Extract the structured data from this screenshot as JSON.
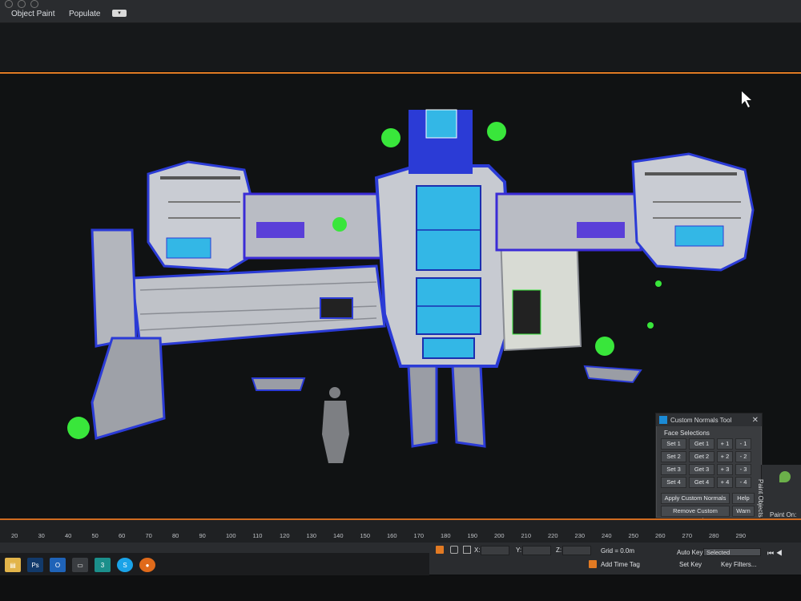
{
  "ribbon": {
    "tabs": [
      "Object Paint",
      "Populate"
    ]
  },
  "tool": {
    "title": "Custom Normals Tool",
    "section": "Face Selections",
    "rows": [
      {
        "set": "Set 1",
        "get": "Get 1",
        "plus": "+ 1",
        "minus": "- 1"
      },
      {
        "set": "Set 2",
        "get": "Get 2",
        "plus": "+ 2",
        "minus": "- 2"
      },
      {
        "set": "Set 3",
        "get": "Get 3",
        "plus": "+ 3",
        "minus": "- 3"
      },
      {
        "set": "Set 4",
        "get": "Get 4",
        "plus": "+ 4",
        "minus": "- 4"
      }
    ],
    "apply": "Apply Custom Normals",
    "help": "Help",
    "remove": "Remove Custom Normals",
    "warn": "Warn",
    "close": "✕"
  },
  "paint_panel": {
    "vertical": "Paint Objects",
    "paint_on": "Paint On:"
  },
  "timeline": {
    "ticks": [
      "20",
      "30",
      "40",
      "50",
      "60",
      "70",
      "80",
      "90",
      "100",
      "110",
      "120",
      "130",
      "140",
      "150",
      "160",
      "170",
      "180",
      "190",
      "200",
      "210",
      "220",
      "230",
      "240",
      "250",
      "260",
      "270",
      "280",
      "290"
    ]
  },
  "status": {
    "x_label": "X:",
    "y_label": "Y:",
    "z_label": "Z:",
    "grid": "Grid = 0.0m",
    "add_time_tag": "Add Time Tag",
    "auto_key": "Auto Key",
    "selected": "Selected",
    "set_key": "Set Key",
    "key_filters": "Key Filters..."
  },
  "taskbar": {
    "apps": [
      "File Explorer",
      "Photoshop",
      "Outlook",
      "Tablet",
      "3ds Max",
      "Skype",
      "Firefox"
    ],
    "app_glyphs": [
      "▤",
      "Ps",
      "O",
      "▭",
      "3",
      "S",
      "●"
    ]
  },
  "colors": {
    "accent": "#e07a24",
    "panel": "#3a3c3f",
    "viewport": "#101213",
    "wire_blue": "#2b3bd6",
    "cyan_glass": "#33b7e6",
    "green_helper": "#39e63b"
  }
}
